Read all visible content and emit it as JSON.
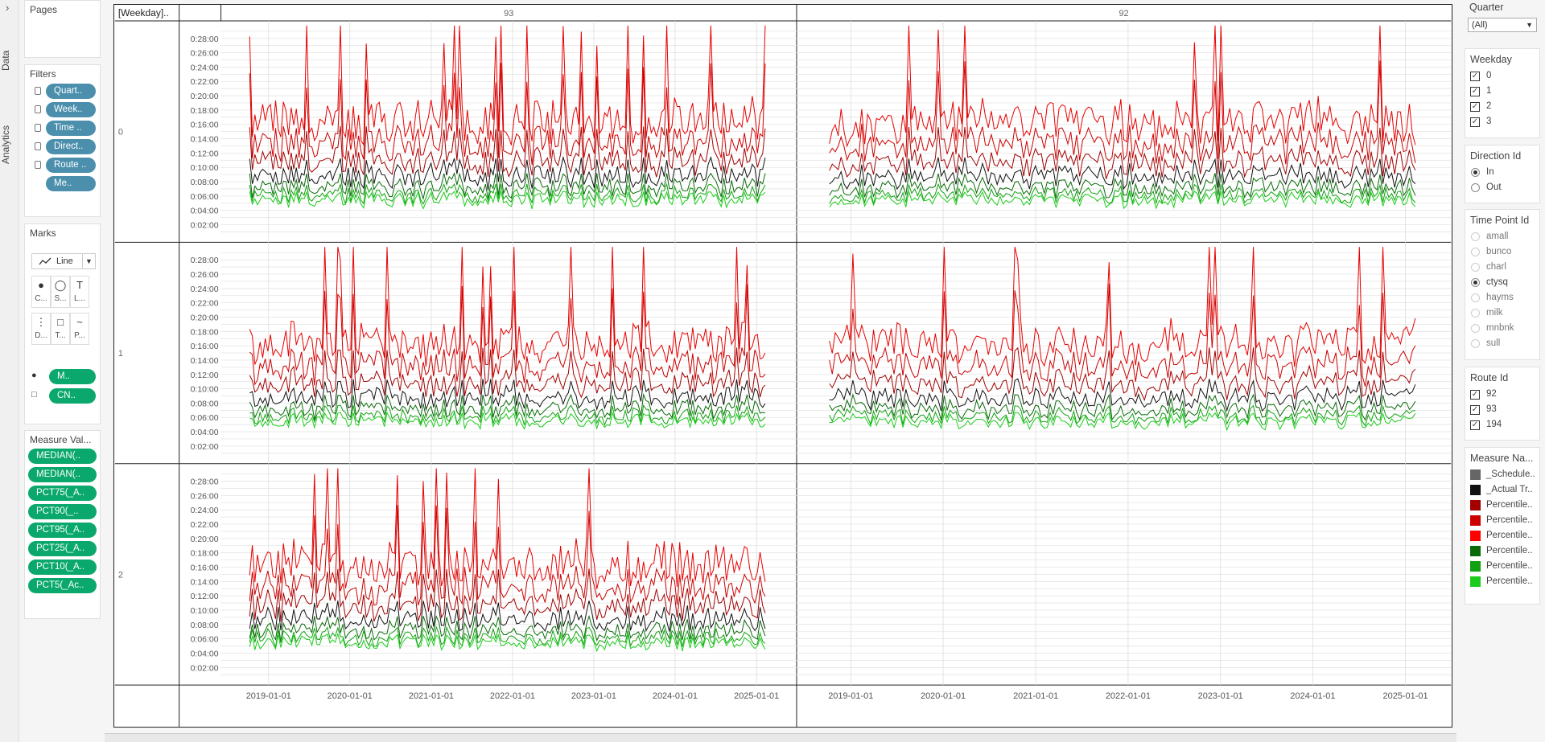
{
  "sidebar": {
    "data_tab": "Data",
    "analytics_tab": "Analytics"
  },
  "pages": {
    "title": "Pages"
  },
  "filters": {
    "title": "Filters",
    "items": [
      "Quart..",
      "Week..",
      "Time ..",
      "Direct..",
      "Route ..",
      "Me.."
    ]
  },
  "marks": {
    "title": "Marks",
    "type": "Line",
    "buttons": [
      {
        "label": "C...",
        "icon": "color-icon"
      },
      {
        "label": "S...",
        "icon": "size-icon"
      },
      {
        "label": "L...",
        "icon": "label-icon"
      },
      {
        "label": "D...",
        "icon": "detail-icon"
      },
      {
        "label": "T...",
        "icon": "tooltip-icon"
      },
      {
        "label": "P...",
        "icon": "path-icon"
      }
    ],
    "pills": [
      "M..",
      "CN.."
    ]
  },
  "measure_values": {
    "title": "Measure Val...",
    "items": [
      "MEDIAN(..",
      "MEDIAN(..",
      "PCT75(_A..",
      "PCT90(_..",
      "PCT95(_A..",
      "PCT25(_A..",
      "PCT10(_A..",
      "PCT5(_Ac.."
    ]
  },
  "chart_data": {
    "type": "line",
    "row_header": "[Weekday]..",
    "columns": [
      "93",
      "92"
    ],
    "rows": [
      "0",
      "1",
      "2"
    ],
    "y_ticks": [
      "0:02:00",
      "0:04:00",
      "0:06:00",
      "0:08:00",
      "0:10:00",
      "0:12:00",
      "0:14:00",
      "0:16:00",
      "0:18:00",
      "0:20:00",
      "0:22:00",
      "0:24:00",
      "0:26:00",
      "0:28:00"
    ],
    "x_ticks": [
      "2019-01-01",
      "2020-01-01",
      "2021-01-01",
      "2022-01-01",
      "2023-01-01",
      "2024-01-01",
      "2025-01-01"
    ],
    "x_range": [
      "2018-06-01",
      "2025-06-30"
    ],
    "y_range_minutes": [
      0,
      30
    ],
    "series": [
      {
        "color": "#e80000",
        "level_min": 16.0,
        "spikes": [
          27.0,
          33.0
        ]
      },
      {
        "color": "#cc0000",
        "level_min": 13.0,
        "spikes": [
          21.0,
          25.0
        ]
      },
      {
        "color": "#a30000",
        "level_min": 10.5,
        "spikes": [
          15.0,
          17.0
        ]
      },
      {
        "color": "#111111",
        "level_min": 8.5,
        "spikes": [
          11.0,
          12.0
        ]
      },
      {
        "color": "#0a6b0a",
        "level_min": 7.0,
        "spikes": [
          9.0,
          9.5
        ]
      },
      {
        "color": "#10a010",
        "level_min": 6.0,
        "spikes": [
          7.5,
          8.0
        ]
      },
      {
        "color": "#1ccc1c",
        "level_min": 5.3,
        "spikes": [
          6.5,
          7.0
        ]
      }
    ]
  },
  "right_filters": {
    "quarter": {
      "title": "Quarter",
      "value": "(All)"
    },
    "weekday": {
      "title": "Weekday",
      "items": [
        "0",
        "1",
        "2",
        "3"
      ]
    },
    "direction": {
      "title": "Direction Id",
      "items": [
        "In",
        "Out"
      ],
      "selected": "In"
    },
    "timepoint": {
      "title": "Time Point Id",
      "items": [
        "amall",
        "bunco",
        "charl",
        "ctysq",
        "hayms",
        "milk",
        "mnbnk",
        "sull"
      ],
      "selected": "ctysq"
    },
    "route": {
      "title": "Route Id",
      "items": [
        "92",
        "93",
        "194"
      ]
    },
    "measure_names": {
      "title": "Measure Na...",
      "items": [
        {
          "label": "_Schedule..",
          "color": "#666666"
        },
        {
          "label": "_Actual Tr..",
          "color": "#111111"
        },
        {
          "label": "Percentile..",
          "color": "#a30000"
        },
        {
          "label": "Percentile..",
          "color": "#cc0000"
        },
        {
          "label": "Percentile..",
          "color": "#ff0000"
        },
        {
          "label": "Percentile..",
          "color": "#0a6b0a"
        },
        {
          "label": "Percentile..",
          "color": "#10a010"
        },
        {
          "label": "Percentile..",
          "color": "#1ccc1c"
        }
      ]
    }
  }
}
